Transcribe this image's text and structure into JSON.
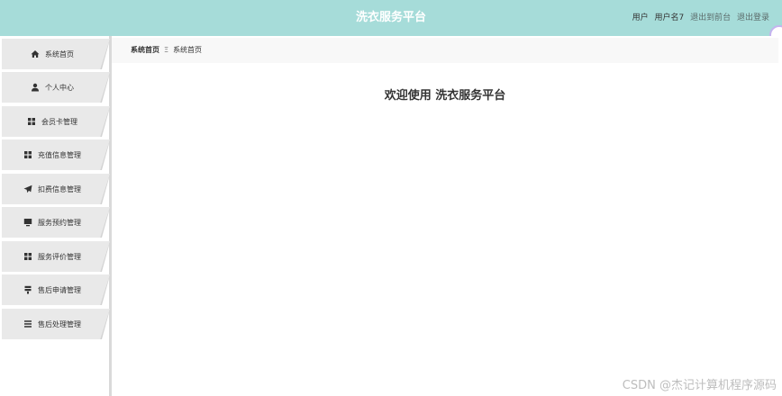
{
  "header": {
    "title": "洗衣服务平台",
    "user_role": "用户",
    "username": "用户名7",
    "back_link": "退出到前台",
    "logout_link": "退出登录"
  },
  "colors": {
    "header_bg": "#a6dcd9",
    "nav_bg": "#e9e9e9"
  },
  "sidebar": {
    "items": [
      {
        "label": "系统首页",
        "icon": "home-icon"
      },
      {
        "label": "个人中心",
        "icon": "user-icon"
      },
      {
        "label": "会员卡管理",
        "icon": "grid-icon"
      },
      {
        "label": "充值信息管理",
        "icon": "grid-icon"
      },
      {
        "label": "扣费信息管理",
        "icon": "send-icon"
      },
      {
        "label": "服务预约管理",
        "icon": "monitor-icon"
      },
      {
        "label": "服务评价管理",
        "icon": "grid-icon"
      },
      {
        "label": "售后申请管理",
        "icon": "tag-icon"
      },
      {
        "label": "售后处理管理",
        "icon": "list-icon"
      }
    ]
  },
  "breadcrumb": {
    "home": "系统首页",
    "separator": "Ξ",
    "current": "系统首页"
  },
  "main": {
    "welcome": "欢迎使用 洗衣服务平台"
  },
  "watermark": "CSDN @杰记计算机程序源码"
}
